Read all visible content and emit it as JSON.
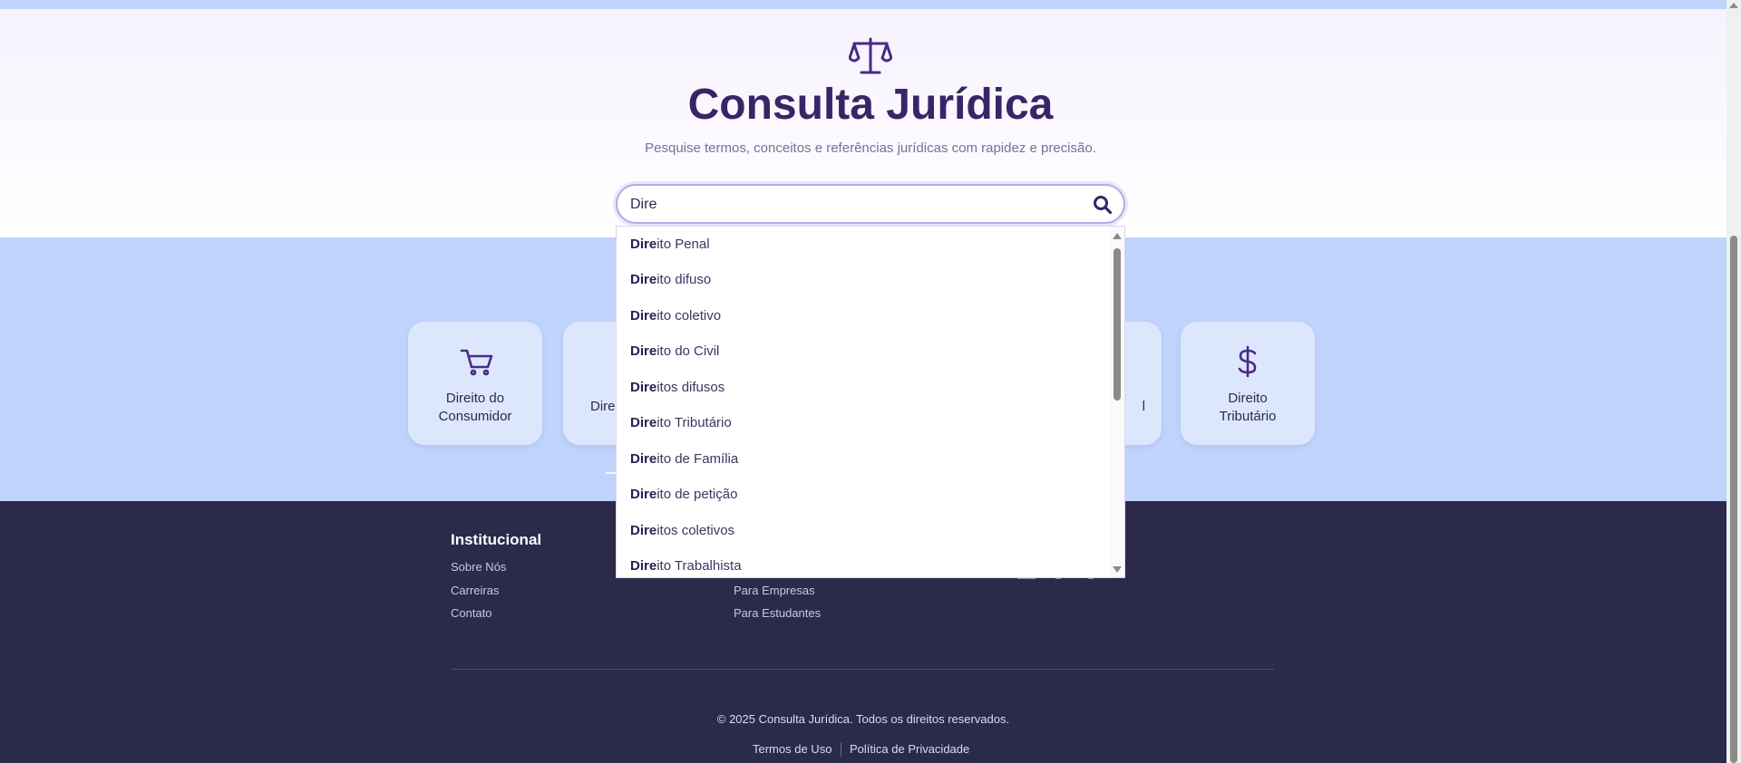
{
  "header": {
    "logo_icon": "scales-of-justice-icon",
    "title": "Consulta Jurídica",
    "subtitle": "Pesquise termos, conceitos e referências jurídicas com rapidez e precisão."
  },
  "search": {
    "value": "Dire",
    "icon": "search-icon"
  },
  "suggestions": [
    {
      "match": "Dire",
      "rest": "ito Penal"
    },
    {
      "match": "Dire",
      "rest": "ito difuso"
    },
    {
      "match": "Dire",
      "rest": "ito coletivo"
    },
    {
      "match": "Dire",
      "rest": "ito do Civil"
    },
    {
      "match": "Dire",
      "rest": "itos difusos"
    },
    {
      "match": "Dire",
      "rest": "ito Tributário"
    },
    {
      "match": "Dire",
      "rest": "ito de Família"
    },
    {
      "match": "Dire",
      "rest": "ito de petição"
    },
    {
      "match": "Dire",
      "rest": "itos coletivos"
    },
    {
      "match": "Dire",
      "rest": "ito Trabalhista"
    }
  ],
  "categories": [
    {
      "label_line1": "Direito do",
      "label_line2": "Consumidor",
      "icon": "shopping-cart-icon"
    },
    {
      "label_partial": "Dire",
      "icon": "hidden"
    },
    {
      "label_partial": "l",
      "icon": "hidden"
    },
    {
      "label_line1": "Direito",
      "label_line2": "Tributário",
      "icon": "dollar-sign-icon"
    }
  ],
  "footer": {
    "institucional_title": "Institucional",
    "institucional_links": [
      "Sobre Nós",
      "Carreiras",
      "Contato"
    ],
    "second_col_links": [
      "Para Empresas",
      "Para Estudantes"
    ],
    "copyright": "© 2025 Consulta Jurídica. Todos os direitos reservados.",
    "terms": "Termos de Uso",
    "privacy": "Política de Privacidade"
  },
  "colors": {
    "accent": "#3a2468",
    "band": "#bfd3fb",
    "footer": "#2c2a4a"
  }
}
